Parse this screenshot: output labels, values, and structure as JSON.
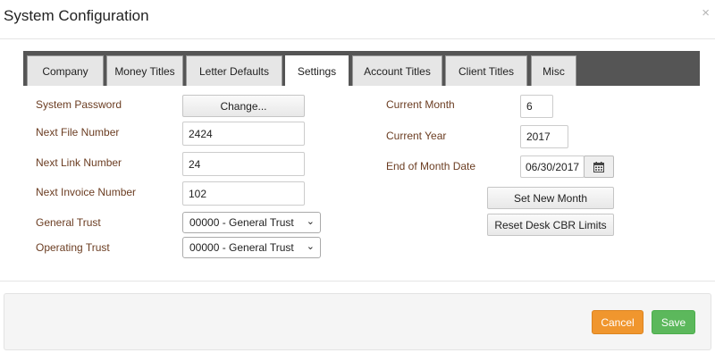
{
  "header": {
    "title": "System Configuration",
    "close_icon": "×"
  },
  "tabs": [
    {
      "label": "Company"
    },
    {
      "label": "Money Titles"
    },
    {
      "label": "Letter Defaults"
    },
    {
      "label": "Settings",
      "active": true
    },
    {
      "label": "Account Titles"
    },
    {
      "label": "Client Titles"
    },
    {
      "label": "Misc"
    }
  ],
  "left": {
    "system_password": {
      "label": "System Password",
      "button": "Change..."
    },
    "next_file_number": {
      "label": "Next File Number",
      "value": "2424"
    },
    "next_link_number": {
      "label": "Next Link Number",
      "value": "24"
    },
    "next_invoice_number": {
      "label": "Next Invoice Number",
      "value": "102"
    },
    "general_trust": {
      "label": "General Trust",
      "value": "00000 - General Trust"
    },
    "operating_trust": {
      "label": "Operating Trust",
      "value": "00000 - General Trust"
    }
  },
  "right": {
    "current_month": {
      "label": "Current Month",
      "value": "6"
    },
    "current_year": {
      "label": "Current Year",
      "value": "2017"
    },
    "end_of_month_date": {
      "label": "End of Month Date",
      "value": "06/30/2017",
      "icon": "calendar-icon"
    },
    "set_new_month_button": "Set New Month",
    "reset_desk_cbr_button": "Reset Desk CBR Limits"
  },
  "footer": {
    "cancel_label": "Cancel",
    "save_label": "Save"
  },
  "colors": {
    "label": "#6b3d22",
    "tabbar": "#555555",
    "cancel": "#f0962e",
    "save": "#5cb85c"
  }
}
